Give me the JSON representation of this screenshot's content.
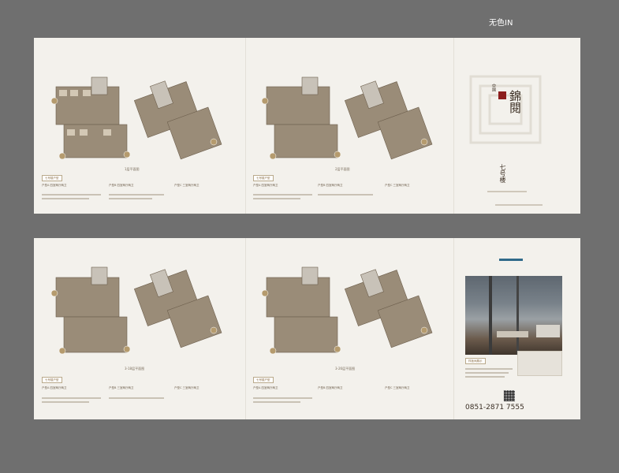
{
  "canvas_label": "无色IN",
  "top_sheet": {
    "plan1_caption": "1层平面图",
    "plan2_caption": "2层平面图",
    "specs_left": [
      "户型A 四室两厅两卫",
      "户型B 四室两厅两卫",
      "户型C 三室两厅两卫"
    ],
    "specs_right": [
      "户型A 四室两厅两卫",
      "户型B 四室两厅两卫",
      "户型C 三室两厅两卫"
    ],
    "tag_left": "七号楼户型",
    "tag_right": "七号楼户型"
  },
  "cover": {
    "brand": "錦閱",
    "building": "七号楼",
    "small": "中国"
  },
  "bottom_sheet": {
    "plan1_caption": "3-18层平面图",
    "plan2_caption": "3-26层平面图",
    "specs_left": [
      "户型A 四室两厅两卫",
      "户型B 三室两厅两卫",
      "户型C 三室两厅两卫"
    ],
    "specs_right": [
      "户型A 四室两厅两卫",
      "户型B 四室两厅两卫",
      "户型C 三室两厅两卫"
    ],
    "tag_left": "七号楼户型",
    "tag_right": "七号楼户型",
    "photo_caption": "样板间展示",
    "phone": "0851-2871  7555"
  }
}
